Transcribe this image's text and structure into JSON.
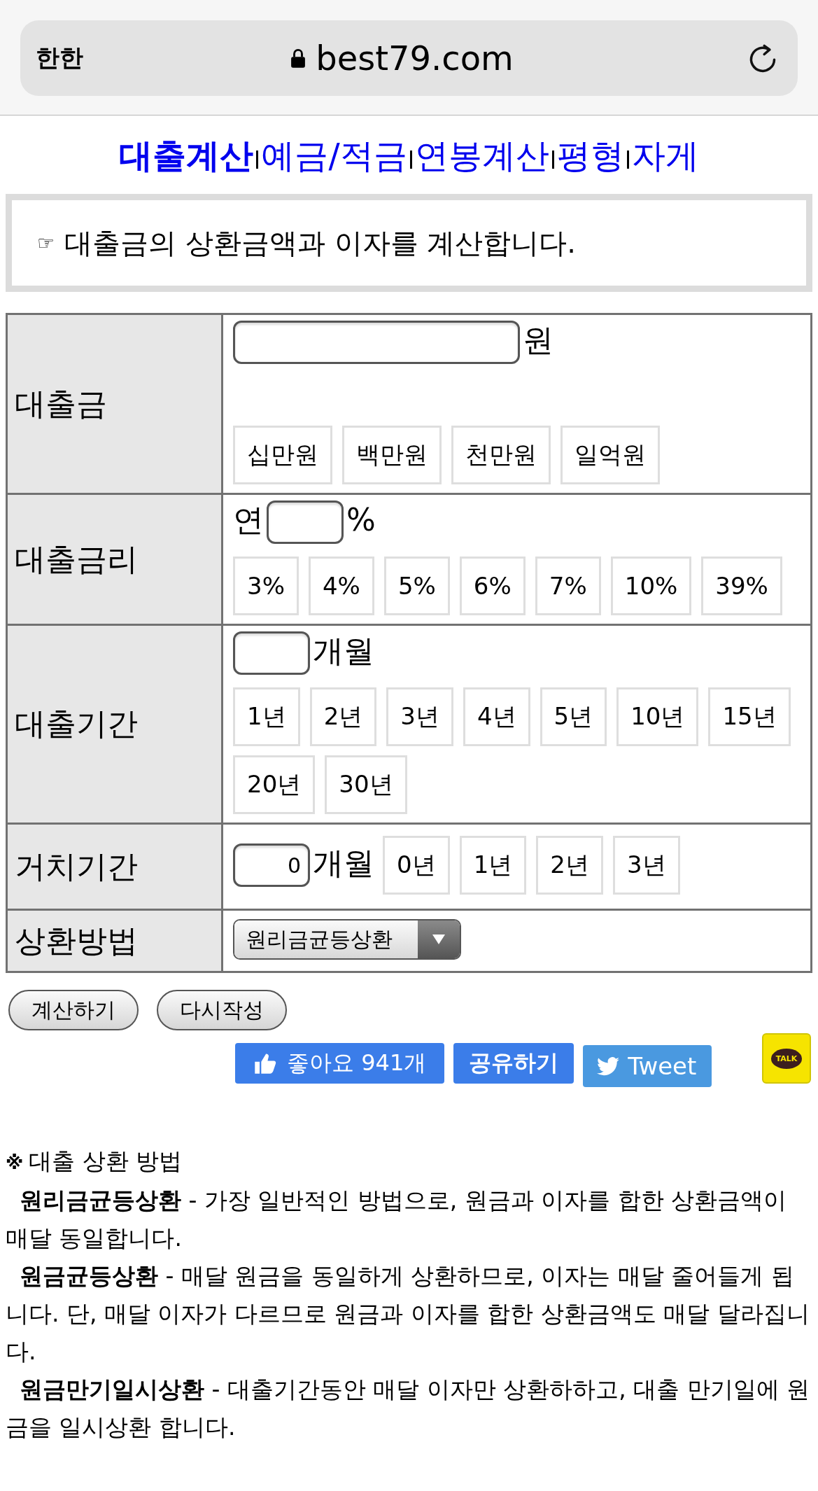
{
  "browser": {
    "text_size_label": "한한",
    "url": "best79.com"
  },
  "nav": [
    {
      "label": "대출계산",
      "selected": true
    },
    {
      "label": "예금/적금",
      "selected": false
    },
    {
      "label": "연봉계산",
      "selected": false
    },
    {
      "label": "평형",
      "selected": false
    },
    {
      "label": "자게",
      "selected": false
    }
  ],
  "intro": {
    "icon": "☞",
    "text": "대출금의 상환금액과 이자를 계산합니다."
  },
  "form": [
    {
      "kind": "amount",
      "label": "대출금",
      "suffix": "원",
      "quick_buttons": [
        "십만원",
        "백만원",
        "천만원",
        "일억원"
      ]
    },
    {
      "kind": "rate",
      "label": "대출금리",
      "prefix": "연",
      "suffix": "%",
      "quick_buttons": [
        "3%",
        "4%",
        "5%",
        "6%",
        "7%",
        "10%",
        "39%"
      ]
    },
    {
      "kind": "term",
      "label": "대출기간",
      "suffix": "개월",
      "quick_buttons": [
        "1년",
        "2년",
        "3년",
        "4년",
        "5년",
        "10년",
        "15년",
        "20년",
        "30년"
      ]
    },
    {
      "kind": "grace",
      "label": "거치기간",
      "value": "0",
      "suffix": "개월",
      "quick_buttons": [
        "0년",
        "1년",
        "2년",
        "3년"
      ]
    }
  ],
  "method": {
    "label": "상환방법",
    "selected_option": "원리금균등상환"
  },
  "actions": [
    "계산하기",
    "다시작성"
  ],
  "social": {
    "like": "좋아요 941개",
    "share": "공유하기",
    "tweet": "Tweet",
    "talk": "TALK"
  },
  "notes": {
    "heading_mark": "※",
    "heading": "대출 상환 방법",
    "items": [
      "**원리금균등상환** - 가장 일반적인 방법으로, 원금과 이자를 합한 상환금액이 매달 동일합니다.",
      "**원금균등상환** - 매달 원금을 동일하게 상환하므로, 이자는 매달 줄어들게 됩니다. 단, 매달 이자가 다르므로 원금과 이자를 합한 상환금액도 매달 달라집니다.",
      "**원금만기일시상환** - 대출기간동안 매달 이자만 상환하하고, 대출 만기일에 원금을 일시상환 합니다."
    ]
  }
}
